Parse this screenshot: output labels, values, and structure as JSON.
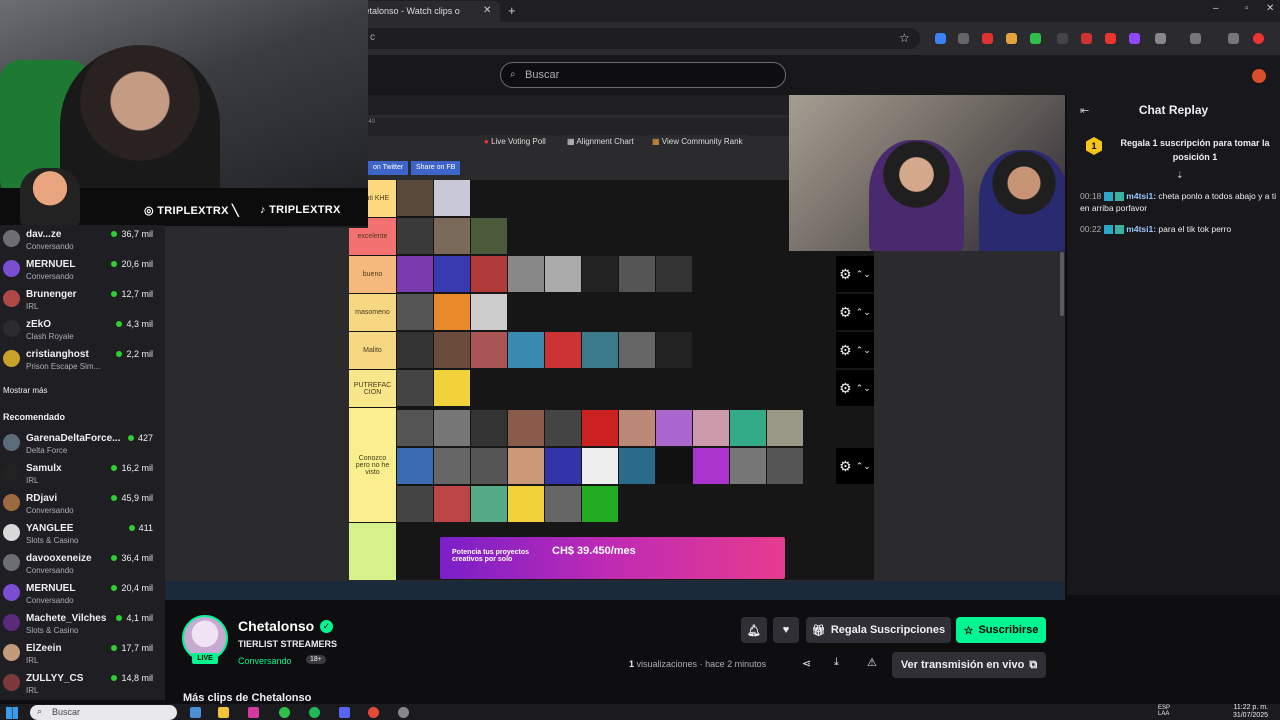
{
  "browser": {
    "tab_title": "Chetalonso - Watch clips o",
    "url_fragment": "c"
  },
  "topnav": {
    "search_placeholder": "Buscar"
  },
  "webcam": {
    "instagram": "TRIPLEXTRX",
    "separator": "╲",
    "tiktok": "TRIPLEXTRX"
  },
  "sidebar": {
    "followed": [
      {
        "name": "dav...ze",
        "category": "Conversando",
        "viewers": "36,7 mil",
        "color": "#6d6d75"
      },
      {
        "name": "MERNUEL",
        "category": "Conversando",
        "viewers": "20,6 mil",
        "color": "#7a4dd1"
      },
      {
        "name": "Brunenger",
        "category": "IRL",
        "viewers": "12,7 mil",
        "color": "#b04848"
      },
      {
        "name": "zEkO",
        "category": "Clash Royale",
        "viewers": "4,3 mil",
        "color": "#2c2c30"
      },
      {
        "name": "cristianghost",
        "category": "Prison Escape Sim...",
        "viewers": "2,2 mil",
        "color": "#c9a22b"
      }
    ],
    "show_more": "Mostrar más",
    "recommended_label": "Recomendado",
    "recommended": [
      {
        "name": "GarenaDeltaForce...",
        "category": "Delta Force",
        "viewers": "427",
        "color": "#5b6b7a"
      },
      {
        "name": "Samulx",
        "category": "IRL",
        "viewers": "16,2 mil",
        "color": "#222"
      },
      {
        "name": "RDjavi",
        "category": "Conversando",
        "viewers": "45,9 mil",
        "color": "#9c6a40"
      },
      {
        "name": "YANGLEE",
        "category": "Slots & Casino",
        "viewers": "411",
        "color": "#d8d8d8"
      },
      {
        "name": "davooxeneize",
        "category": "Conversando",
        "viewers": "36,4 mil",
        "color": "#6d6d75"
      },
      {
        "name": "MERNUEL",
        "category": "Conversando",
        "viewers": "20,4 mil",
        "color": "#7a4dd1"
      },
      {
        "name": "Machete_Vilches",
        "category": "Slots & Casino",
        "viewers": "4,1 mil",
        "color": "#5b2a7a"
      },
      {
        "name": "ElZeein",
        "category": "IRL",
        "viewers": "17,7 mil",
        "color": "#c49b7a"
      },
      {
        "name": "ZULLYY_CS",
        "category": "IRL",
        "viewers": "14,8 mil",
        "color": "#7a3a3a"
      }
    ]
  },
  "tierlist": {
    "tiers": [
      {
        "label": "Lo ati KHE",
        "color": "#ffd97f"
      },
      {
        "label": "excelente",
        "color": "#f47171"
      },
      {
        "label": "bueno",
        "color": "#f5b97c"
      },
      {
        "label": "masomeno",
        "color": "#f6d883"
      },
      {
        "label": "Malito",
        "color": "#f6d883"
      },
      {
        "label": "PUTREFAC CION",
        "color": "#f7e68a"
      },
      {
        "label": "Conozco pero no he visto",
        "color": "#f9ef8e"
      },
      {
        "label": "",
        "color": "#d6f08b"
      }
    ],
    "buttons": [
      "Live Voting Poll",
      "Alignment Chart",
      "View Community Rank"
    ],
    "share": [
      "on Twitter",
      "Share on FB"
    ],
    "ad_price": "CH$ 39.450/mes",
    "ad_text": "Potencia tus proyectos creativos por solo"
  },
  "chat": {
    "title": "Chat Replay",
    "gift_badge": "1",
    "gift_text": "Regala 1 suscripción para tomar la posición 1",
    "messages": [
      {
        "time": "00:18",
        "user": "m4tsi1:",
        "text": "cheta ponlo a todos abajo y a ti en arriba porfavor"
      },
      {
        "time": "00:22",
        "user": "m4tsi1:",
        "text": "para el tik tok perro"
      }
    ]
  },
  "clip": {
    "live_tag": "LIVE",
    "channel": "Chetalonso",
    "title": "TIERLIST STREAMERS",
    "category": "Conversando",
    "age": "18+",
    "views_count": "1",
    "views_label": "visualizaciones",
    "time_ago": "· hace 2 minutos",
    "gift_subs": "Regala Suscripciones",
    "subscribe": "Suscribirse",
    "watch_live": "Ver transmisión en vivo",
    "more_clips": "Más clips de Chetalonso"
  },
  "taskbar": {
    "search": "Buscar",
    "lang": "ESP\nLAA",
    "time": "11:22 p. m.",
    "date": "31/07/2025"
  },
  "colors": {
    "accent": "#00f593",
    "brand": "#9147ff"
  }
}
